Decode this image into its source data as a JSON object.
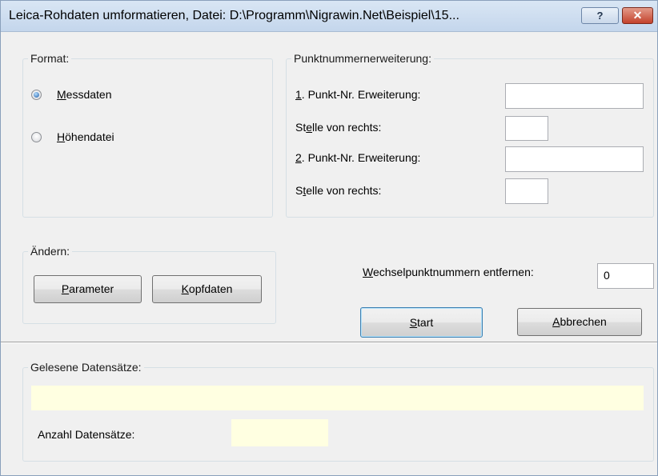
{
  "window": {
    "title": "Leica-Rohdaten umformatieren, Datei: D:\\Programm\\Nigrawin.Net\\Beispiel\\15...",
    "help_label": "?",
    "close_label": "✕"
  },
  "format": {
    "legend": "Format:",
    "options": [
      {
        "accel": "M",
        "rest": "essdaten",
        "selected": true
      },
      {
        "accel": "H",
        "rest": "öhendatei",
        "selected": false
      }
    ]
  },
  "punkt": {
    "legend": "Punktnummernerweiterung:",
    "ext1_accel": "1",
    "ext1_rest": ". Punkt-Nr. Erweiterung:",
    "ext1_value": "",
    "pos1_pre": "St",
    "pos1_accel": "e",
    "pos1_rest": "lle von rechts:",
    "pos1_value": "",
    "ext2_accel": "2",
    "ext2_rest": ". Punkt-Nr. Erweiterung:",
    "ext2_value": "",
    "pos2_pre": "S",
    "pos2_accel": "t",
    "pos2_rest": "elle von rechts:",
    "pos2_value": ""
  },
  "aendern": {
    "legend": "Ändern:",
    "parameter_accel": "P",
    "parameter_rest": "arameter",
    "kopfdaten_accel": "K",
    "kopfdaten_rest": "opfdaten"
  },
  "wechsel": {
    "label_accel": "W",
    "label_rest": "echselpunktnummern entfernen:",
    "value": "0"
  },
  "actions": {
    "start_accel": "S",
    "start_rest": "tart",
    "cancel_accel": "A",
    "cancel_rest": "bbrechen"
  },
  "gelesen": {
    "legend": "Gelesene Datensätze:",
    "record_text": "",
    "count_label": "Anzahl Datensätze:",
    "count_value": ""
  },
  "colors": {
    "readonly_bg": "#ffffe1",
    "close_red": "#c4422c"
  }
}
